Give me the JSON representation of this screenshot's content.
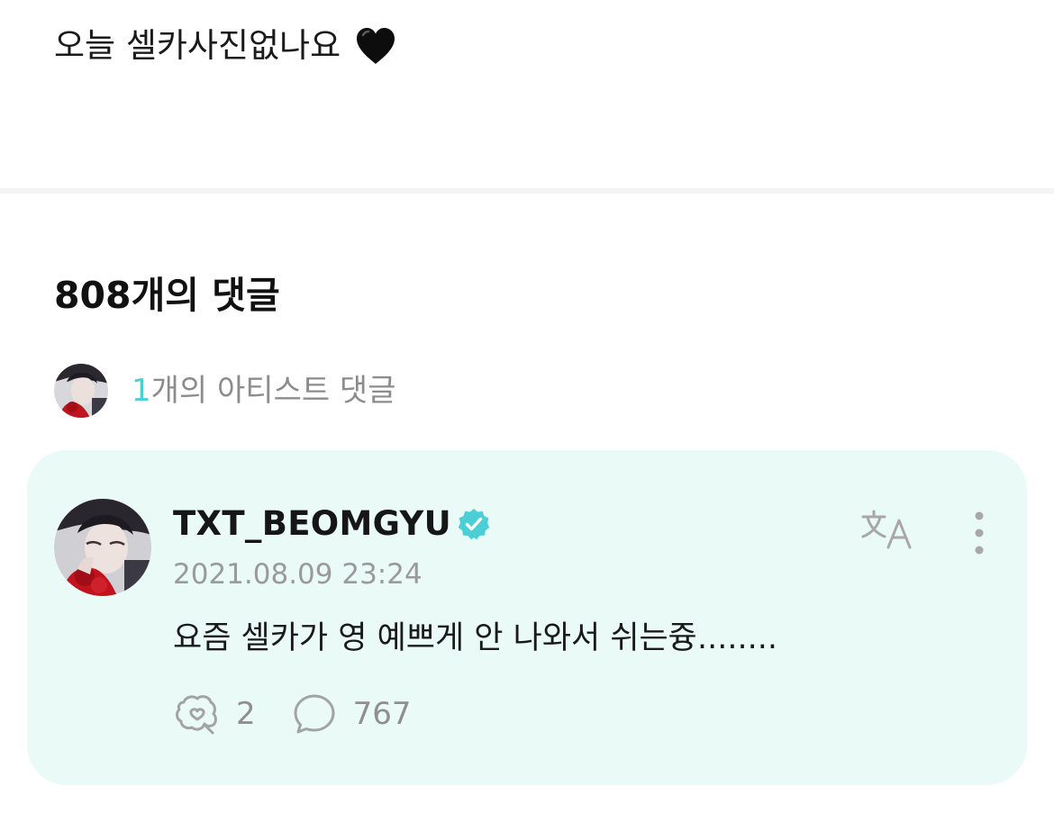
{
  "post": {
    "text": "오늘 셀카사진없나요",
    "emoji_icon": "black-heart-icon"
  },
  "comments_section": {
    "title": "808개의 댓글",
    "artist_summary": {
      "count": "1",
      "suffix": "개의 아티스트 댓글"
    }
  },
  "comment": {
    "author": "TXT_BEOMGYU",
    "verified_icon": "verified-badge-icon",
    "date": "2021.08.09 23:24",
    "body": "요즘 셀카가 영 예쁘게 안 나와서 쉬는즁........",
    "like_count": "2",
    "reply_count": "767",
    "translate_icon": "translate-icon",
    "more_icon": "more-vertical-icon"
  },
  "colors": {
    "accent": "#4ccfd4",
    "card_background": "#eafaf7",
    "muted_text": "#9a9a9a"
  }
}
